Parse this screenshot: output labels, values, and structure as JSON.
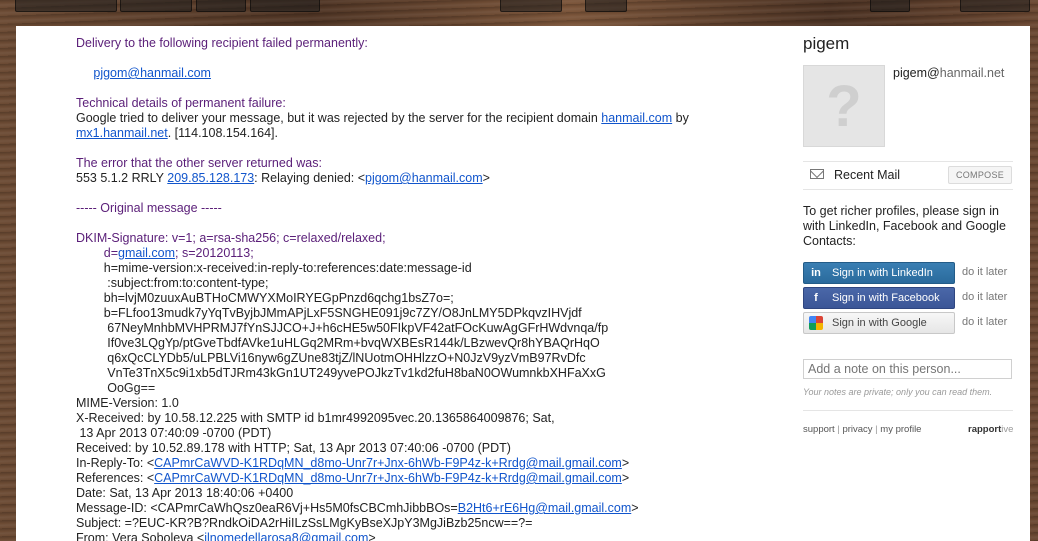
{
  "message": {
    "lines": [
      {
        "parts": [
          {
            "t": "Delivery to the following recipient failed permanently:",
            "c": "purple"
          }
        ]
      },
      {
        "parts": []
      },
      {
        "parts": [
          {
            "t": "     "
          },
          {
            "t": "pjgom@hanmail.com",
            "link": true
          }
        ]
      },
      {
        "parts": []
      },
      {
        "parts": [
          {
            "t": "Technical details of permanent failure:",
            "c": "purple"
          }
        ]
      },
      {
        "parts": [
          {
            "t": "Google tried to deliver your message, but it was rejected by the server for the recipient domain "
          },
          {
            "t": "hanmail.com",
            "link": true
          },
          {
            "t": " by"
          }
        ]
      },
      {
        "parts": [
          {
            "t": "mx1.hanmail.net",
            "link": true
          },
          {
            "t": ". [114.108.154.164]."
          }
        ]
      },
      {
        "parts": []
      },
      {
        "parts": [
          {
            "t": "The error that the other server returned was:",
            "c": "purple"
          }
        ]
      },
      {
        "parts": [
          {
            "t": "553 5.1.2 RRLY "
          },
          {
            "t": "209.85.128.173",
            "link": true
          },
          {
            "t": ": Relaying denied: <"
          },
          {
            "t": "pjgom@hanmail.com",
            "link": true
          },
          {
            "t": ">"
          }
        ]
      },
      {
        "parts": []
      },
      {
        "parts": [
          {
            "t": "----- Original message -----",
            "c": "purple"
          }
        ]
      },
      {
        "parts": []
      },
      {
        "parts": [
          {
            "t": "DKIM-Signature: v=1; a=rsa-sha256; c=relaxed/relaxed;",
            "c": "purple"
          }
        ]
      },
      {
        "parts": [
          {
            "t": "        d=",
            "c": "purple"
          },
          {
            "t": "gmail.com",
            "link": true
          },
          {
            "t": "; s=20120113;",
            "c": "purple"
          }
        ]
      },
      {
        "parts": [
          {
            "t": "        h=mime-version:x-received:in-reply-to:references:date:message-id"
          }
        ]
      },
      {
        "parts": [
          {
            "t": "         :subject:from:to:content-type;"
          }
        ]
      },
      {
        "parts": [
          {
            "t": "        bh=lvjM0zuuxAuBTHoCMWYXMoIRYEGpPnzd6qchg1bsZ7o=;"
          }
        ]
      },
      {
        "parts": [
          {
            "t": "        b=FLfoo13mudk7yYqTvByjbJMmAPjLxF5SNGHE091j9c7ZY/O8JnLMY5DPkqvzIHVjdf"
          }
        ]
      },
      {
        "parts": [
          {
            "t": "         67NeyMnhbMVHPRMJ7fYnSJJCO+J+h6cHE5w50FIkpVF42atFOcKuwAgGFrHWdvnqa/fp"
          }
        ]
      },
      {
        "parts": [
          {
            "t": "         If0ve3LQgYp/ptGveTbdfAVke1uHLGq2MRm+bvqWXBEsR144k/LBzwevQr8hYBAQrHqO"
          }
        ]
      },
      {
        "parts": [
          {
            "t": "         q6xQcCLYDb5/uLPBLVi16nyw6gZUne83tjZ/lNUotmOHHlzzO+N0JzV9yzVmB97RvDfc"
          }
        ]
      },
      {
        "parts": [
          {
            "t": "         VnTe3TnX5c9i1xb5dTJRm43kGn1UT249yvePOJkzTv1kd2fuH8baN0OWumnkbXHFaXxG"
          }
        ]
      },
      {
        "parts": [
          {
            "t": "         OoGg=="
          }
        ]
      },
      {
        "parts": [
          {
            "t": "MIME-Version: 1.0"
          }
        ]
      },
      {
        "parts": [
          {
            "t": "X-Received: by 10.58.12.225 with SMTP id b1mr4992095vec.20.1365864009876; Sat,"
          }
        ]
      },
      {
        "parts": [
          {
            "t": " 13 Apr 2013 07:40:09 -0700 (PDT)"
          }
        ]
      },
      {
        "parts": [
          {
            "t": "Received: by 10.52.89.178 with HTTP; Sat, 13 Apr 2013 07:40:06 -0700 (PDT)"
          }
        ]
      },
      {
        "parts": [
          {
            "t": "In-Reply-To: <"
          },
          {
            "t": "CAPmrCaWVD-K1RDqMN_d8mo-Unr7r+Jnx-6hWb-F9P4z-k+Rrdg@mail.gmail.com",
            "link": true
          },
          {
            "t": ">"
          }
        ]
      },
      {
        "parts": [
          {
            "t": "References: <"
          },
          {
            "t": "CAPmrCaWVD-K1RDqMN_d8mo-Unr7r+Jnx-6hWb-F9P4z-k+Rrdg@mail.gmail.com",
            "link": true
          },
          {
            "t": ">"
          }
        ]
      },
      {
        "parts": [
          {
            "t": "Date: Sat, 13 Apr 2013 18:40:06 +0400"
          }
        ]
      },
      {
        "parts": [
          {
            "t": "Message-ID: <CAPmrCaWhQsz0eaR6Vj+Hs5M0fsCBCmhJibbBOs="
          },
          {
            "t": "B2Ht6+rE6Hg@mail.gmail.com",
            "link": true
          },
          {
            "t": ">"
          }
        ]
      },
      {
        "parts": [
          {
            "t": "Subject: =?EUC-KR?B?RndkOiDA2rHiILzSsLMgKyBseXJpY3MgJiBzb25ncw==?="
          }
        ]
      },
      {
        "parts": [
          {
            "t": "From: Vera Soboleva <"
          },
          {
            "t": "ilnomedellarosa8@gmail.com",
            "link": true
          },
          {
            "t": ">"
          }
        ]
      }
    ]
  },
  "contact": {
    "name": "pigem",
    "email_user": "pigem@",
    "email_domain": "hanmail.net",
    "avatar_glyph": "?"
  },
  "recent": {
    "label": "Recent Mail",
    "compose_label": "COMPOSE"
  },
  "promo_text": "To get richer profiles, please sign in with LinkedIn, Facebook and Google Contacts:",
  "sign_in": {
    "linkedin": {
      "label": "Sign in with LinkedIn",
      "later": "do it later",
      "icon": "in"
    },
    "facebook": {
      "label": "Sign in with Facebook",
      "later": "do it later",
      "icon": "f"
    },
    "google": {
      "label": "Sign in with Google",
      "later": "do it later"
    }
  },
  "note": {
    "placeholder": "Add a note on this person...",
    "hint": "Your notes are private; only you can read them."
  },
  "footer": {
    "support": "support",
    "privacy": "privacy",
    "profile": "my profile",
    "brand_main": "rapport",
    "brand_tail": "ive"
  }
}
